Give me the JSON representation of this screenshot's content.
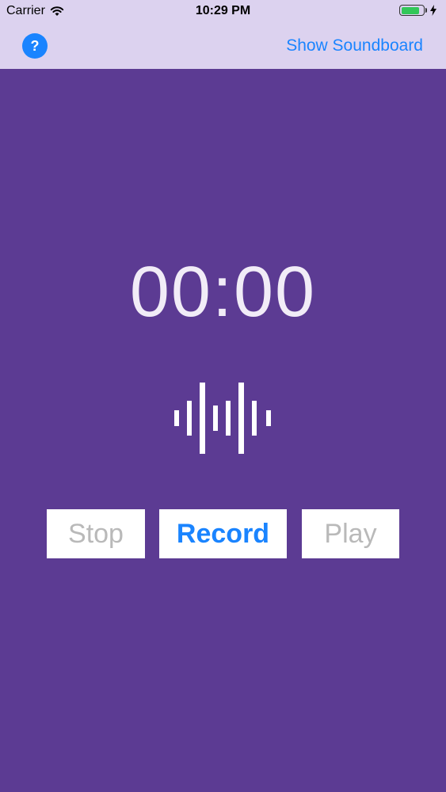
{
  "status_bar": {
    "carrier": "Carrier",
    "time": "10:29 PM",
    "battery_level": 0.85,
    "signal_icon": "wifi-icon",
    "charging_icon": "bolt-icon"
  },
  "nav": {
    "help_label": "?",
    "show_soundboard": "Show Soundboard"
  },
  "timer": {
    "value": "00:00"
  },
  "controls": {
    "stop": "Stop",
    "record": "Record",
    "play": "Play"
  },
  "colors": {
    "background": "#5c3b93",
    "nav_background": "#dcd2ef",
    "accent": "#1a84ff",
    "disabled_text": "#b9b9b9"
  }
}
